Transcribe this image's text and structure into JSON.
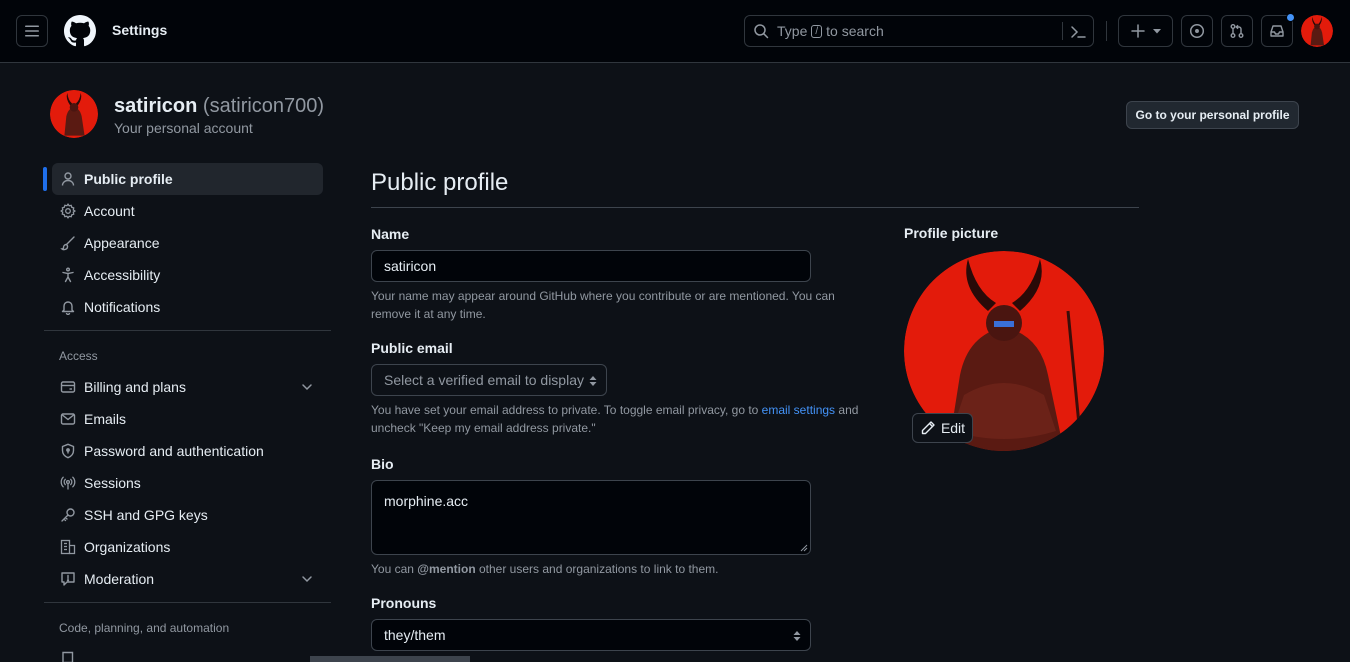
{
  "header": {
    "context_title": "Settings",
    "search_prefix": "Type",
    "search_key": "/",
    "search_suffix": "to search"
  },
  "account": {
    "username": "satiricon",
    "handle": "(satiricon700)",
    "subtitle": "Your personal account",
    "goto_profile_label": "Go to your personal profile"
  },
  "sidebar": {
    "items": [
      {
        "label": "Public profile",
        "icon": "person-icon",
        "active": true
      },
      {
        "label": "Account",
        "icon": "gear-icon"
      },
      {
        "label": "Appearance",
        "icon": "paintbrush-icon"
      },
      {
        "label": "Accessibility",
        "icon": "accessibility-icon"
      },
      {
        "label": "Notifications",
        "icon": "bell-icon"
      }
    ],
    "access_heading": "Access",
    "access_items": [
      {
        "label": "Billing and plans",
        "icon": "credit-card-icon",
        "expandable": true
      },
      {
        "label": "Emails",
        "icon": "mail-icon"
      },
      {
        "label": "Password and authentication",
        "icon": "shield-lock-icon"
      },
      {
        "label": "Sessions",
        "icon": "broadcast-icon"
      },
      {
        "label": "SSH and GPG keys",
        "icon": "key-icon"
      },
      {
        "label": "Organizations",
        "icon": "organization-icon"
      },
      {
        "label": "Moderation",
        "icon": "report-icon",
        "expandable": true
      }
    ],
    "code_heading": "Code, planning, and automation"
  },
  "main": {
    "title": "Public profile",
    "name_label": "Name",
    "name_value": "satiricon",
    "name_note": "Your name may appear around GitHub where you contribute or are mentioned. You can remove it at any time.",
    "email_label": "Public email",
    "email_placeholder": "Select a verified email to display",
    "email_note_prefix": "You have set your email address to private. To toggle email privacy, go to",
    "email_note_link": "email settings",
    "email_note_suffix": "and uncheck \"Keep my email address private.\"",
    "bio_label": "Bio",
    "bio_value": "morphine.acc",
    "bio_note_prefix": "You can",
    "bio_note_mention": "@mention",
    "bio_note_suffix": "other users and organizations to link to them.",
    "pronouns_label": "Pronouns",
    "pronouns_value": "they/them",
    "picture_label": "Profile picture",
    "edit_label": "Edit"
  },
  "colors": {
    "accent": "#1f6feb",
    "link": "#4493f8",
    "avatar_red": "#e31b0b"
  }
}
